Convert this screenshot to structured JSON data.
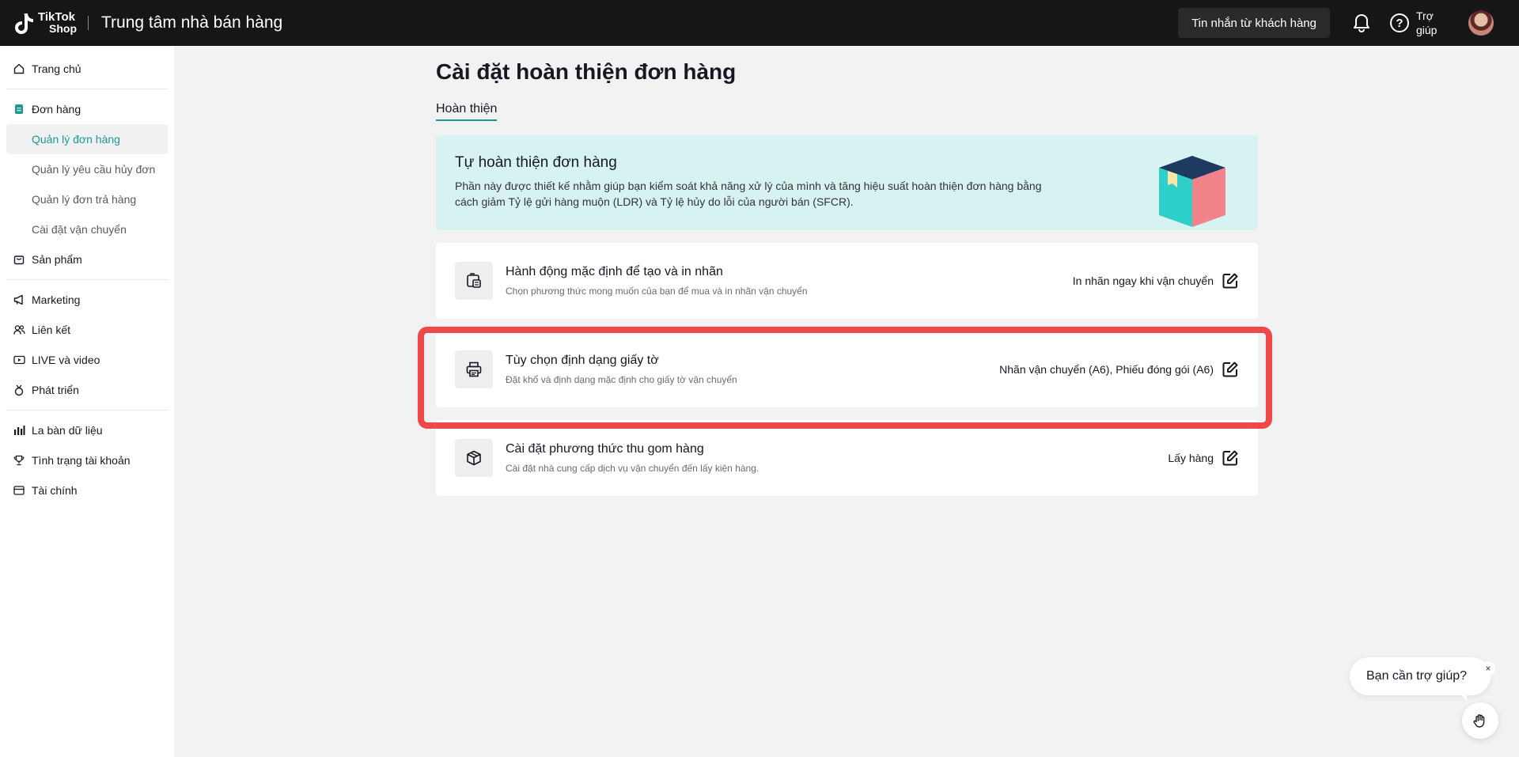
{
  "header": {
    "logo_line1": "TikTok",
    "logo_line2": "Shop",
    "app_title": "Trung tâm nhà bán hàng",
    "message_button": "Tin nhắn từ khách hàng",
    "help_label": "Trợ giúp",
    "icons": {
      "bell": "bell-icon",
      "help": "question-circle-icon",
      "avatar": "user-avatar"
    }
  },
  "sidebar": {
    "home": "Trang chủ",
    "orders": "Đơn hàng",
    "orders_sub": [
      "Quản lý đơn hàng",
      "Quản lý yêu cầu hủy đơn",
      "Quản lý đơn trả hàng",
      "Cài đặt vận chuyển"
    ],
    "products": "Sản phẩm",
    "marketing": "Marketing",
    "affiliate": "Liên kết",
    "live_video": "LIVE và video",
    "growth": "Phát triển",
    "data_compass": "La bàn dữ liệu",
    "account_health": "Tình trạng tài khoản",
    "finance": "Tài chính"
  },
  "main": {
    "page_title": "Cài đặt hoàn thiện đơn hàng",
    "tab": "Hoàn thiện",
    "banner": {
      "title": "Tự hoàn thiện đơn hàng",
      "description": "Phần này được thiết kế nhằm giúp bạn kiểm soát khả năng xử lý của mình và tăng hiệu suất hoàn thiện đơn hàng bằng cách giảm Tỷ lệ gửi hàng muộn (LDR) và Tỷ lệ hủy do lỗi của người bán (SFCR)."
    },
    "cards": [
      {
        "title": "Hành động mặc định để tạo và in nhãn",
        "subtitle": "Chọn phương thức mong muốn của bạn để mua và in nhãn vận chuyển",
        "value": "In nhãn ngay khi vận chuyển",
        "icon": "label-print-icon"
      },
      {
        "title": "Tùy chọn định dạng giấy tờ",
        "subtitle": "Đặt khổ và định dạng mặc định cho giấy tờ vận chuyển",
        "value": "Nhãn vận chuyển (A6), Phiếu đóng gói (A6)",
        "icon": "printer-icon"
      },
      {
        "title": "Cài đặt phương thức thu gom hàng",
        "subtitle": "Cài đặt nhà cung cấp dịch vụ vận chuyển đến lấy kiện hàng.",
        "value": "Lấy hàng",
        "icon": "package-icon"
      }
    ]
  },
  "help_widget": {
    "text": "Bạn cần trợ giúp?",
    "close": "×"
  },
  "colors": {
    "accent": "#1a9a94",
    "highlight": "#ef4848",
    "topbar": "#161616",
    "banner": "#d6f3f2"
  }
}
